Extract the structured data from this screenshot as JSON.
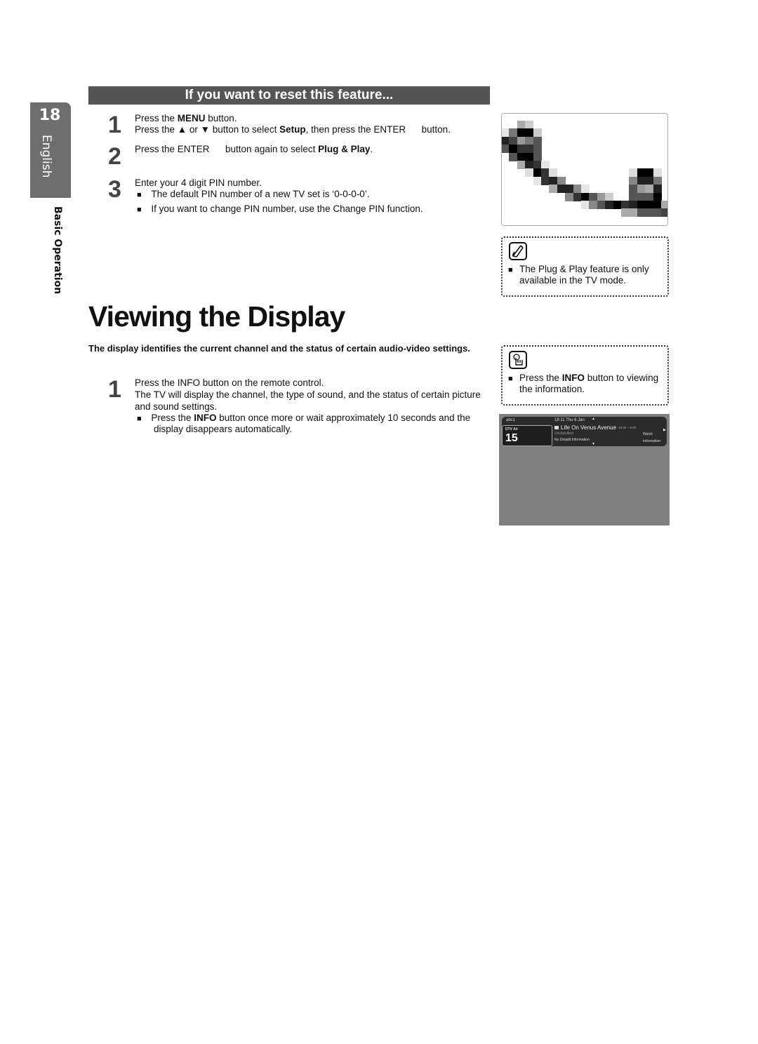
{
  "side_tab": {
    "page_number": "18",
    "language": "English",
    "section": "Basic Operation"
  },
  "reset_section": {
    "banner": "If you want to reset this feature...",
    "steps": [
      {
        "number": "1",
        "lines": [
          {
            "parts": [
              {
                "t": "Press the "
              },
              {
                "t": "MENU",
                "b": false
              },
              {
                "t": " button."
              }
            ]
          },
          {
            "parts": [
              {
                "t": "Press the ▲ or ▼ button to select "
              },
              {
                "t": "Setup",
                "b": true
              },
              {
                "t": ", then press the ENTER      button."
              }
            ]
          }
        ]
      },
      {
        "number": "2",
        "lines": [
          {
            "parts": [
              {
                "t": "Press the ENTER      button again to select "
              },
              {
                "t": "Plug & Play",
                "b": true
              },
              {
                "t": "."
              }
            ]
          }
        ]
      },
      {
        "number": "3",
        "lines": [
          {
            "parts": [
              {
                "t": "Enter your 4 digit PIN number."
              }
            ]
          }
        ],
        "bullets": [
          "The default PIN number of a new TV set is ‘0-0-0-0’.",
          "If you want to change PIN number, use the Change PIN function."
        ]
      }
    ]
  },
  "note_plug_play": {
    "icon": "note-pencil-icon",
    "text": "The Plug & Play feature is only available in the TV mode."
  },
  "viewing_section": {
    "title": "Viewing the Display",
    "intro": "The display identifies the current channel and the status of certain audio-video settings.",
    "step": {
      "number": "1",
      "line1_pre": "Press the ",
      "line1_key": "INFO",
      "line1_post": " button on the remote control.",
      "line2": "The TV will display the channel, the type of sound, and the status of certain picture",
      "line3": "and sound settings.",
      "bullet_pre": "Press the ",
      "bullet_key": "INFO",
      "bullet_post1": " button once more or wait approximately 10 seconds and the",
      "bullet_post2": "display disappears automatically."
    }
  },
  "note_info": {
    "icon": "hand-press-icon",
    "pre": "Press the ",
    "key": "INFO",
    "post1": " button to viewing",
    "post2": "the information."
  },
  "tv_display": {
    "channel_name": "abc1",
    "source": "DTV Air",
    "channel_number": "15",
    "datetime": "18:11 Thu 6 Jan",
    "program_title": "Life On Venus Avenue",
    "program_time": "18:00 ~ 6:00",
    "rating": "Unclassified",
    "detail": "No Detaild Information",
    "action_watch": "Watch",
    "action_info": "Information"
  },
  "cable_image": {
    "description": "pixelated cable figure",
    "cells": [
      [
        0,
        2,
        "#aaaaaa"
      ],
      [
        0,
        3,
        "#cccccc"
      ],
      [
        1,
        0,
        "#e5e5e5"
      ],
      [
        1,
        1,
        "#777777"
      ],
      [
        1,
        2,
        "#000000"
      ],
      [
        1,
        3,
        "#000000"
      ],
      [
        1,
        4,
        "#cccccc"
      ],
      [
        2,
        0,
        "#222222"
      ],
      [
        2,
        1,
        "#444444"
      ],
      [
        2,
        2,
        "#999999"
      ],
      [
        2,
        3,
        "#777777"
      ],
      [
        2,
        4,
        "#555555"
      ],
      [
        3,
        0,
        "#555555"
      ],
      [
        3,
        1,
        "#000000"
      ],
      [
        3,
        2,
        "#333333"
      ],
      [
        3,
        3,
        "#333333"
      ],
      [
        3,
        4,
        "#555555"
      ],
      [
        4,
        1,
        "#555555"
      ],
      [
        4,
        2,
        "#000000"
      ],
      [
        4,
        3,
        "#000000"
      ],
      [
        4,
        4,
        "#555555"
      ],
      [
        5,
        2,
        "#aaaaaa"
      ],
      [
        5,
        3,
        "#222222"
      ],
      [
        5,
        4,
        "#333333"
      ],
      [
        5,
        5,
        "#e5e5e5"
      ],
      [
        6,
        3,
        "#dddddd"
      ],
      [
        6,
        4,
        "#000000"
      ],
      [
        6,
        5,
        "#333333"
      ],
      [
        6,
        6,
        "#dddddd"
      ],
      [
        6,
        16,
        "#dddddd"
      ],
      [
        6,
        17,
        "#000000"
      ],
      [
        6,
        18,
        "#000000"
      ],
      [
        6,
        19,
        "#dddddd"
      ],
      [
        7,
        4,
        "#e5e5e5"
      ],
      [
        7,
        5,
        "#333333"
      ],
      [
        7,
        6,
        "#222222"
      ],
      [
        7,
        7,
        "#888888"
      ],
      [
        7,
        16,
        "#888888"
      ],
      [
        7,
        17,
        "#222222"
      ],
      [
        7,
        18,
        "#222222"
      ],
      [
        7,
        19,
        "#777777"
      ],
      [
        8,
        6,
        "#aaaaaa"
      ],
      [
        8,
        7,
        "#222222"
      ],
      [
        8,
        8,
        "#222222"
      ],
      [
        8,
        9,
        "#888888"
      ],
      [
        8,
        10,
        "#e5e5e5"
      ],
      [
        8,
        16,
        "#555555"
      ],
      [
        8,
        17,
        "#999999"
      ],
      [
        8,
        18,
        "#aaaaaa"
      ],
      [
        8,
        19,
        "#222222"
      ],
      [
        9,
        8,
        "#888888"
      ],
      [
        9,
        9,
        "#333333"
      ],
      [
        9,
        10,
        "#000000"
      ],
      [
        9,
        11,
        "#555555"
      ],
      [
        9,
        12,
        "#999999"
      ],
      [
        9,
        13,
        "#cccccc"
      ],
      [
        9,
        16,
        "#555555"
      ],
      [
        9,
        17,
        "#555555"
      ],
      [
        9,
        18,
        "#555555"
      ],
      [
        9,
        19,
        "#000000"
      ],
      [
        10,
        10,
        "#e5e5e5"
      ],
      [
        10,
        11,
        "#888888"
      ],
      [
        10,
        12,
        "#555555"
      ],
      [
        10,
        13,
        "#222222"
      ],
      [
        10,
        14,
        "#000000"
      ],
      [
        10,
        15,
        "#333333"
      ],
      [
        10,
        16,
        "#222222"
      ],
      [
        10,
        17,
        "#000000"
      ],
      [
        10,
        18,
        "#000000"
      ],
      [
        10,
        19,
        "#000000"
      ],
      [
        10,
        20,
        "#aaaaaa"
      ],
      [
        11,
        15,
        "#aaaaaa"
      ],
      [
        11,
        16,
        "#aaaaaa"
      ],
      [
        11,
        17,
        "#555555"
      ],
      [
        11,
        18,
        "#555555"
      ],
      [
        11,
        19,
        "#555555"
      ],
      [
        11,
        20,
        "#444444"
      ]
    ]
  }
}
